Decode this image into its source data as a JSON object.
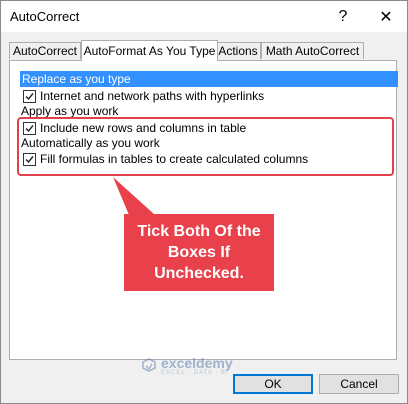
{
  "window": {
    "title": "AutoCorrect",
    "help_icon": "?",
    "close_icon": "✕"
  },
  "tabs": [
    {
      "label": "AutoCorrect",
      "active": false
    },
    {
      "label": "AutoFormat As You Type",
      "active": true
    },
    {
      "label": "Actions",
      "active": false
    },
    {
      "label": "Math AutoCorrect",
      "active": false
    }
  ],
  "sections": [
    {
      "header": "Replace as you type",
      "items": [
        {
          "label": "Internet and network paths with hyperlinks",
          "checked": true
        }
      ]
    },
    {
      "header": "Apply as you work",
      "items": [
        {
          "label": "Include new rows and columns in table",
          "checked": true
        }
      ]
    },
    {
      "header": "Automatically as you work",
      "items": [
        {
          "label": "Fill formulas in tables to create calculated columns",
          "checked": true
        }
      ]
    }
  ],
  "annotation": {
    "line1": "Tick Both Of the",
    "line2": "Boxes If",
    "line3": "Unchecked.",
    "color": "#e9414b"
  },
  "watermark": {
    "name": "exceldemy",
    "tagline": "EXCEL · DATA · BI"
  },
  "buttons": {
    "ok": "OK",
    "cancel": "Cancel"
  }
}
